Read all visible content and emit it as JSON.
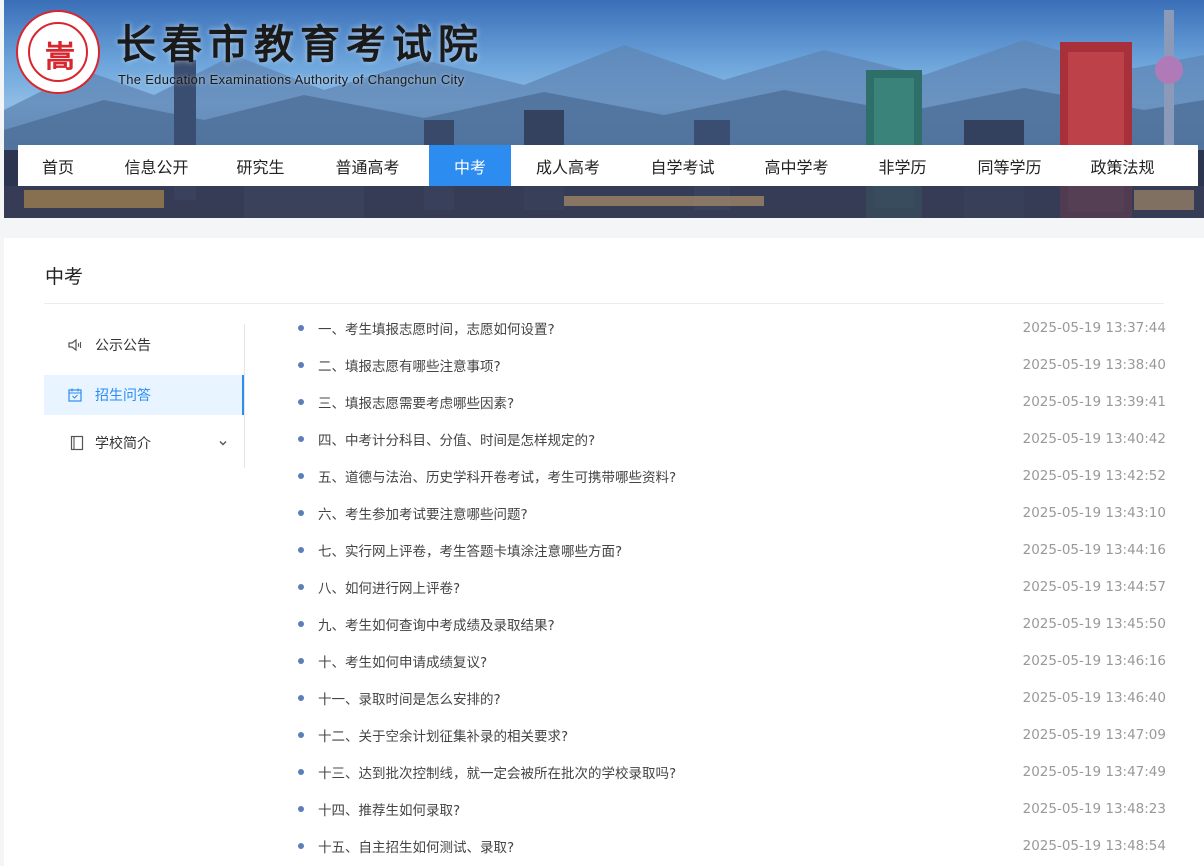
{
  "header": {
    "title": "长春市教育考试院",
    "subtitle": "The Education Examinations Authority of Changchun City",
    "logo_mark": "嵩",
    "brand_color": "#d8262e"
  },
  "nav": {
    "items": [
      {
        "label": "首页"
      },
      {
        "label": "信息公开"
      },
      {
        "label": "研究生"
      },
      {
        "label": "普通高考"
      },
      {
        "label": "中考",
        "active": true
      },
      {
        "label": "成人高考"
      },
      {
        "label": "自学考试"
      },
      {
        "label": "高中学考"
      },
      {
        "label": "非学历"
      },
      {
        "label": "同等学历"
      },
      {
        "label": "政策法规"
      }
    ],
    "active_color": "#2d8cf0"
  },
  "page": {
    "title": "中考"
  },
  "sidebar": {
    "items": [
      {
        "label": "公示公告",
        "icon": "speaker-icon"
      },
      {
        "label": "招生问答",
        "icon": "calendar-icon",
        "active": true
      },
      {
        "label": "学校简介",
        "icon": "document-icon",
        "expandable": true
      }
    ]
  },
  "articles": [
    {
      "title": "一、考生填报志愿时间，志愿如何设置?",
      "date": "2025-05-19 13:37:44"
    },
    {
      "title": "二、填报志愿有哪些注意事项?",
      "date": "2025-05-19 13:38:40"
    },
    {
      "title": "三、填报志愿需要考虑哪些因素?",
      "date": "2025-05-19 13:39:41"
    },
    {
      "title": "四、中考计分科目、分值、时间是怎样规定的?",
      "date": "2025-05-19 13:40:42"
    },
    {
      "title": "五、道德与法治、历史学科开卷考试，考生可携带哪些资料?",
      "date": "2025-05-19 13:42:52"
    },
    {
      "title": "六、考生参加考试要注意哪些问题?",
      "date": "2025-05-19 13:43:10"
    },
    {
      "title": "七、实行网上评卷，考生答题卡填涂注意哪些方面?",
      "date": "2025-05-19 13:44:16"
    },
    {
      "title": "八、如何进行网上评卷?",
      "date": "2025-05-19 13:44:57"
    },
    {
      "title": "九、考生如何查询中考成绩及录取结果?",
      "date": "2025-05-19 13:45:50"
    },
    {
      "title": "十、考生如何申请成绩复议?",
      "date": "2025-05-19 13:46:16"
    },
    {
      "title": "十一、录取时间是怎么安排的?",
      "date": "2025-05-19 13:46:40"
    },
    {
      "title": "十二、关于空余计划征集补录的相关要求?",
      "date": "2025-05-19 13:47:09"
    },
    {
      "title": "十三、达到批次控制线，就一定会被所在批次的学校录取吗?",
      "date": "2025-05-19 13:47:49"
    },
    {
      "title": "十四、推荐生如何录取?",
      "date": "2025-05-19 13:48:23"
    },
    {
      "title": "十五、自主招生如何测试、录取?",
      "date": "2025-05-19 13:48:54"
    }
  ]
}
